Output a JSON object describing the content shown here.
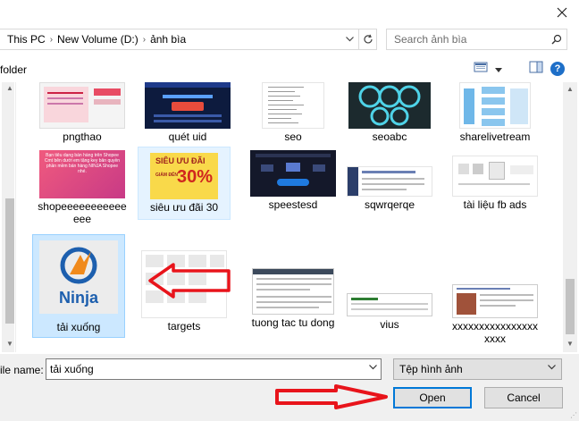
{
  "addressbar": {
    "crumbs": [
      "This PC",
      "New Volume (D:)",
      "ảnh bìa"
    ]
  },
  "search": {
    "placeholder": "Search ảnh bìa"
  },
  "toolbar": {
    "new_folder_label": "folder",
    "help_label": "?"
  },
  "files": [
    {
      "label": "pngthao",
      "state": "normal"
    },
    {
      "label": "quét uid",
      "state": "normal"
    },
    {
      "label": "seo",
      "state": "normal"
    },
    {
      "label": "seoabc",
      "state": "normal"
    },
    {
      "label": "sharelivetream",
      "state": "normal"
    },
    {
      "label": "shopeeeeeeeeeeeeee",
      "state": "normal",
      "thumb_text": "Bạn tiêu dạng bán hàng trên Shopee Cmt bên dưới em tặng key bản quyền phần mềm bán hàng NINJA Shopee nhé."
    },
    {
      "label": "siêu ưu đãi 30",
      "state": "hover",
      "thumb_text": "SIÊU ƯU ĐÃI",
      "thumb_badge": "30%",
      "thumb_small": "GIẢM ĐẾN"
    },
    {
      "label": "speestesd",
      "state": "normal"
    },
    {
      "label": "sqwrqerqe",
      "state": "normal"
    },
    {
      "label": "tài liệu fb ads",
      "state": "normal"
    },
    {
      "label": "tải xuống",
      "state": "selected",
      "thumb_text": "Ninja"
    },
    {
      "label": "targets",
      "state": "normal"
    },
    {
      "label": "tuong tac tu dong",
      "state": "normal"
    },
    {
      "label": "vius",
      "state": "normal"
    },
    {
      "label": "xxxxxxxxxxxxxxxxxxxx",
      "state": "normal"
    }
  ],
  "bottom": {
    "file_name_label": "ile name:",
    "file_name_value": "tải xuống",
    "file_type_value": "Tệp hình ảnh",
    "open_label": "Open",
    "cancel_label": "Cancel"
  },
  "colors": {
    "selection_bg": "#cce8ff",
    "hover_bg": "#e5f3ff",
    "annotation_red": "#e8141b",
    "open_border": "#0078d7"
  }
}
